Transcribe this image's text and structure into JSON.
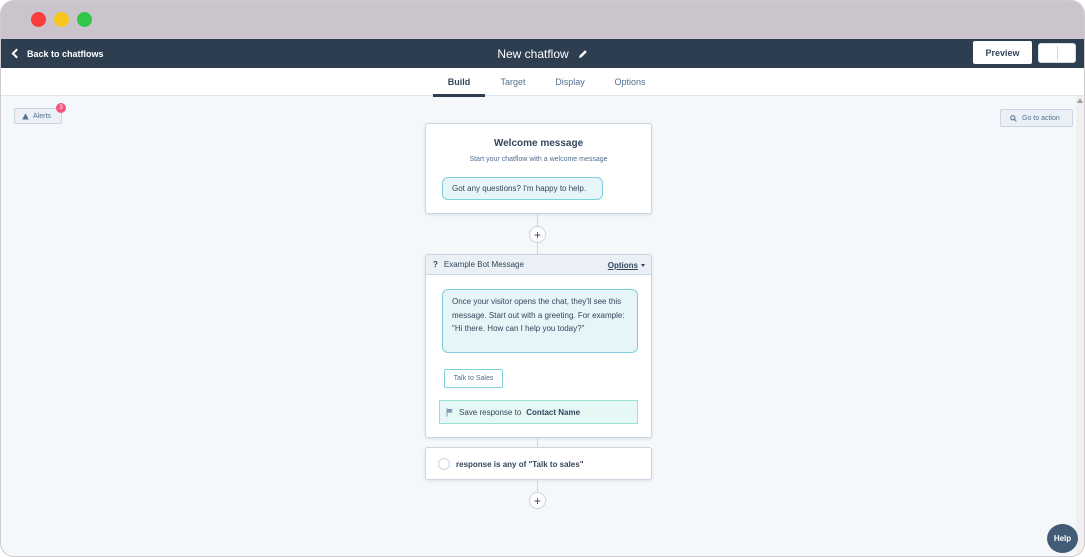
{
  "window": {
    "controls": [
      "close",
      "minimize",
      "maximize"
    ]
  },
  "topbar": {
    "back_label": "Back to chatflows",
    "title": "New chatflow",
    "preview_label": "Preview"
  },
  "tabs": [
    {
      "label": "Build",
      "active": true
    },
    {
      "label": "Target",
      "active": false
    },
    {
      "label": "Display",
      "active": false
    },
    {
      "label": "Options",
      "active": false
    }
  ],
  "canvas": {
    "alerts_label": "Alerts",
    "alerts_count": "3",
    "goto_label": "Go to action"
  },
  "welcome": {
    "title": "Welcome message",
    "subtitle": "Start your chatflow with a welcome message",
    "message": "Got any questions? I'm happy to help."
  },
  "bot_message": {
    "icon_glyph": "?",
    "title": "Example Bot Message",
    "options_label": "Options",
    "message": "Once your visitor opens the chat, they'll see this message. Start out with a greeting. For example: \"Hi there. How can I help you today?\"",
    "quick_reply": "Talk to Sales",
    "save_prefix": "Save response to",
    "save_property": "Contact Name"
  },
  "branch": {
    "condition": "response is any of \"Talk to sales\""
  },
  "add_step_glyph": "+",
  "help_label": "Help",
  "colors": {
    "titlebar": "#cbc4cc",
    "navbar": "#2d3e50",
    "canvas": "#f5f8fa",
    "bubble_bg": "#e5f5f8",
    "bubble_border": "#7fd1de",
    "badge": "#f2547d",
    "help": "#425b76"
  }
}
